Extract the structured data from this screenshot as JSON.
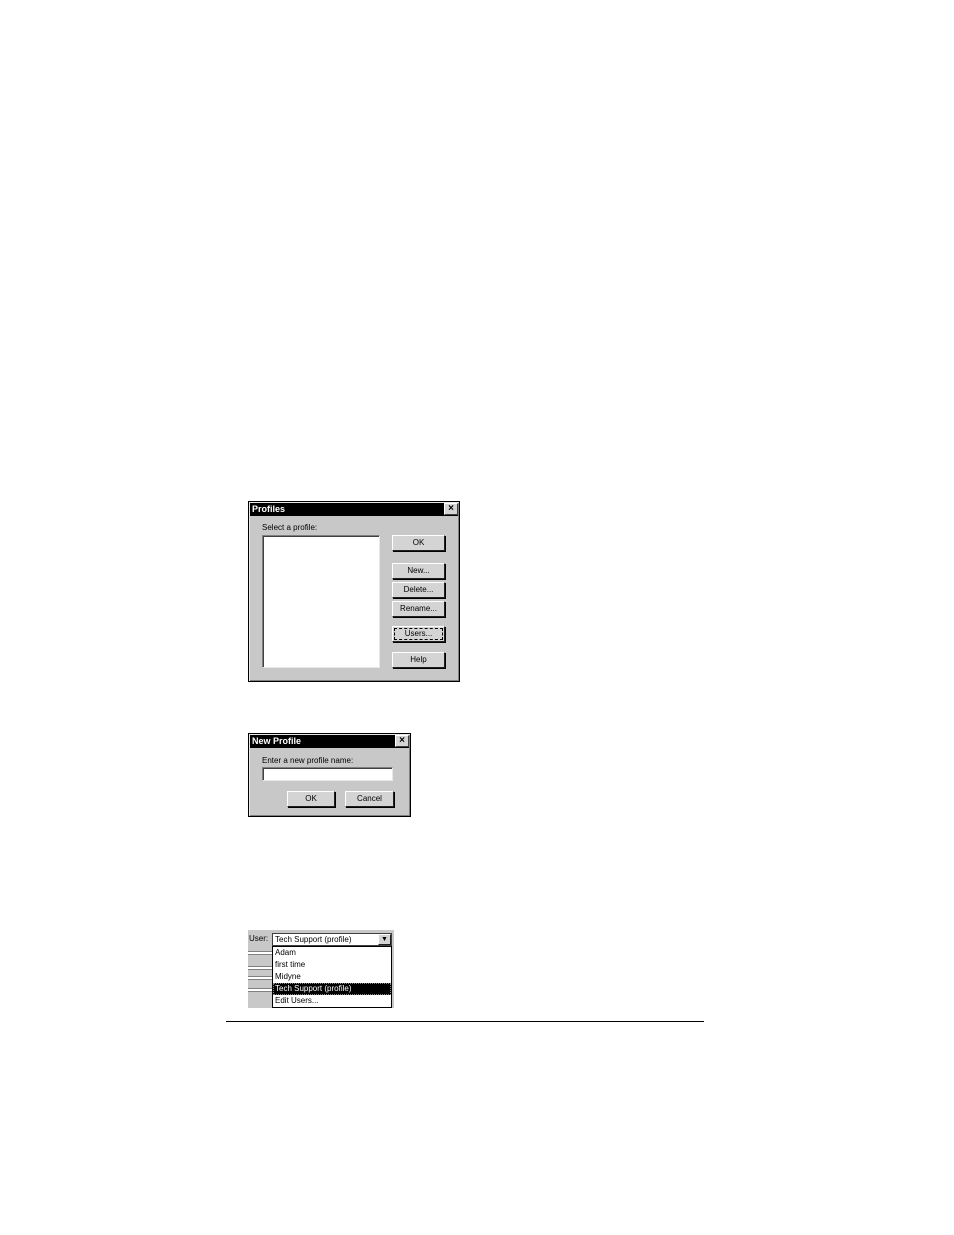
{
  "profiles_dialog": {
    "title": "Profiles",
    "close_glyph": "×",
    "prompt": "Select a profile:",
    "buttons": {
      "ok": "OK",
      "new": "New...",
      "delete": "Delete...",
      "rename": "Rename...",
      "users": "Users...",
      "help": "Help"
    }
  },
  "new_profile_dialog": {
    "title": "New Profile",
    "close_glyph": "×",
    "prompt": "Enter a new profile name:",
    "input_value": "",
    "buttons": {
      "ok": "OK",
      "cancel": "Cancel"
    }
  },
  "user_selector": {
    "label": "User:",
    "selected": "Tech Support (profile)",
    "arrow_glyph": "▼",
    "options": [
      "Adam",
      "first time",
      "Midyne",
      "Tech Support (profile)",
      "Edit Users..."
    ],
    "highlighted_index": 3
  }
}
